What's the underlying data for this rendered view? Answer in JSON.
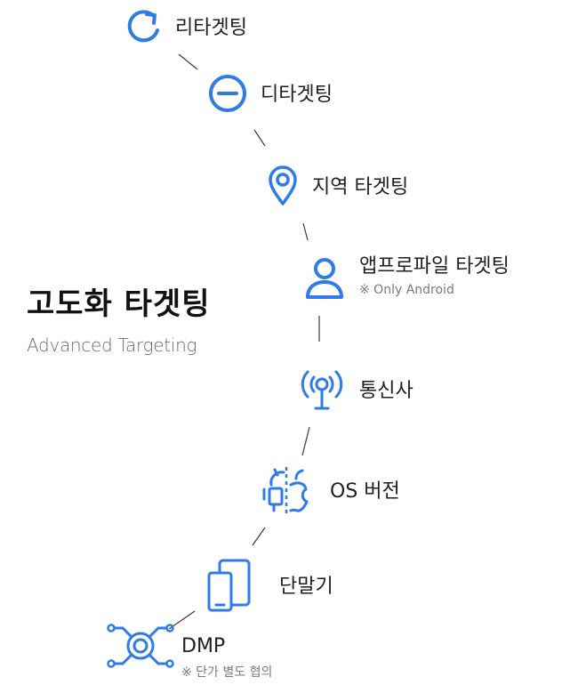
{
  "accent": "#2f7bea",
  "connector_color": "#3b3b3b",
  "heading": {
    "title": "고도화 타겟팅",
    "subtitle": "Advanced Targeting"
  },
  "items": [
    {
      "label": "리타겟팅",
      "icon": "refresh-icon"
    },
    {
      "label": "디타겟팅",
      "icon": "minus-circle-icon"
    },
    {
      "label": "지역 타겟팅",
      "icon": "map-pin-icon"
    },
    {
      "label": "앱프로파일 타겟팅",
      "note": "※ Only Android",
      "icon": "user-icon"
    },
    {
      "label": "통신사",
      "icon": "antenna-icon"
    },
    {
      "label": "OS 버전",
      "icon": "android-apple-icon"
    },
    {
      "label": "단말기",
      "icon": "devices-icon"
    },
    {
      "label": "DMP",
      "note": "※ 단가 별도 협의",
      "icon": "dmp-network-icon"
    }
  ]
}
